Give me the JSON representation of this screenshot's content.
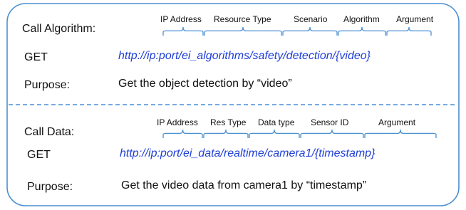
{
  "colors": {
    "border": "#4a8fd3",
    "url": "#1f3fd6",
    "text": "#111111"
  },
  "sections": [
    {
      "title": "Call Algorithm:",
      "method": "GET",
      "url": "http://ip:port/ei_algorithms/safety/detection/{video}",
      "segment_labels": [
        "IP Address",
        "Resource Type",
        "Scenario",
        "Algorithm",
        "Argument"
      ],
      "purpose_label": "Purpose:",
      "purpose_text": "Get the object detection by “video”"
    },
    {
      "title": "Call Data:",
      "method": "GET",
      "url": "http://ip:port/ei_data/realtime/camera1/{timestamp}",
      "segment_labels": [
        "IP Address",
        "Res Type",
        "Data type",
        "Sensor ID",
        "Argument"
      ],
      "purpose_label": "Purpose:",
      "purpose_text": "Get the video data from camera1 by “timestamp”"
    }
  ]
}
